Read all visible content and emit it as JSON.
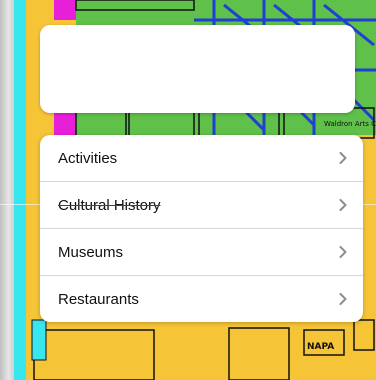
{
  "map": {
    "labels": [
      "Waldron Arts Center",
      "NAPA"
    ],
    "colors": {
      "yellow": "#f6c437",
      "green": "#5fc04a",
      "blue": "#1f3fd6",
      "magenta": "#e81fd8",
      "cyan": "#38e6ef"
    }
  },
  "menu": {
    "items": [
      {
        "label": "Activities",
        "icon": "chevron-right-icon"
      },
      {
        "label": "Cultural History",
        "icon": "chevron-right-icon"
      },
      {
        "label": "Museums",
        "icon": "chevron-right-icon"
      },
      {
        "label": "Restaurants",
        "icon": "chevron-right-icon"
      }
    ]
  }
}
